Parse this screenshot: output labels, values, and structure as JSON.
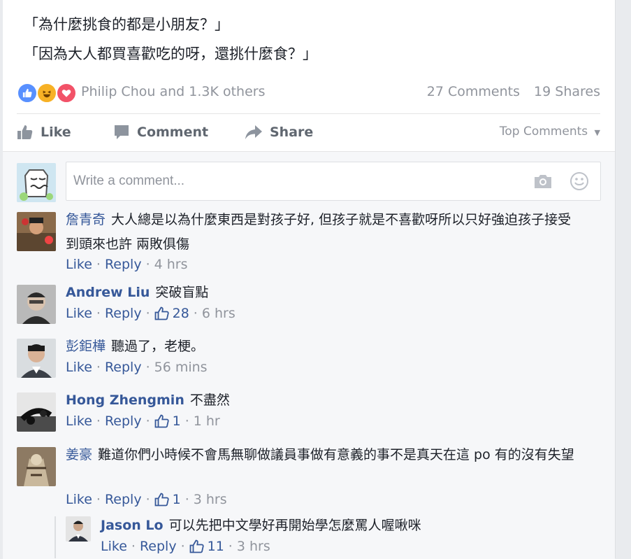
{
  "post": {
    "lines": [
      "「為什麼挑食的都是小朋友？」",
      "「因為大人都買喜歡吃的呀，還挑什麼食？」"
    ]
  },
  "reactions": {
    "names": "Philip Chou and 1.3K others",
    "comments_count": "27 Comments",
    "shares_count": "19 Shares"
  },
  "actions": {
    "like": "Like",
    "comment": "Comment",
    "share": "Share",
    "sort": "Top Comments"
  },
  "compose": {
    "placeholder": "Write a comment..."
  },
  "comments": [
    {
      "author": "詹青奇",
      "text": "大人總是以為什麼東西是對孩子好, 但孩子就是不喜歡呀所以只好強迫孩子接受到頭來也許 兩敗俱傷",
      "like": "Like",
      "reply": "Reply",
      "likes": "",
      "time": "4 hrs"
    },
    {
      "author": "Andrew Liu",
      "text": "突破盲點",
      "like": "Like",
      "reply": "Reply",
      "likes": "28",
      "time": "6 hrs"
    },
    {
      "author": "彭鉅樺",
      "text": "聽過了，老梗。",
      "like": "Like",
      "reply": "Reply",
      "likes": "",
      "time": "56 mins"
    },
    {
      "author": "Hong Zhengmin",
      "text": "不盡然",
      "like": "Like",
      "reply": "Reply",
      "likes": "1",
      "time": "1 hr"
    },
    {
      "author": "姜豪",
      "text": "難道你們小時候不會馬無聊做議員事做有意義的事不是真天在這 po 有的沒有失望",
      "like": "Like",
      "reply": "Reply",
      "likes": "1",
      "time": "3 hrs"
    }
  ],
  "reply": {
    "author": "Jason Lo",
    "text": "可以先把中文學好再開始學怎麼罵人喔啾咪",
    "like": "Like",
    "reply": "Reply",
    "likes": "11",
    "time": "3 hrs"
  },
  "colors": {
    "link": "#365899",
    "meta": "#90949c",
    "like_blue": "#5890ff",
    "haha": "#f7b125",
    "love": "#f25268"
  }
}
